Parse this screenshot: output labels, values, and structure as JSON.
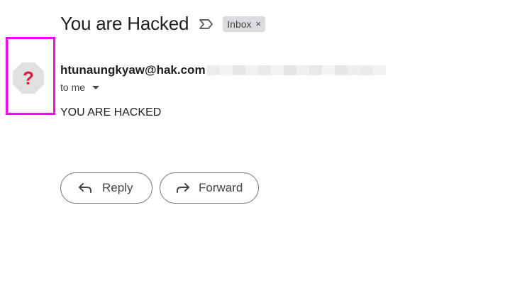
{
  "email": {
    "subject": "You are Hacked",
    "label": "Inbox",
    "label_remove": "×",
    "sender_email": "htunaungkyaw@hak.com",
    "recipient_text": "to me",
    "body": "YOU ARE HACKED",
    "avatar_glyph": "?"
  },
  "actions": {
    "reply_label": "Reply",
    "forward_label": "Forward"
  },
  "colors": {
    "highlight": "#ff00ff",
    "avatar_bg": "#e0e0e0",
    "avatar_glyph": "#e8173f"
  },
  "icons": {
    "important": "important-marker-icon",
    "avatar": "unknown-sender-icon",
    "caret": "caret-down-icon",
    "reply": "reply-arrow-icon",
    "forward": "forward-arrow-icon"
  }
}
